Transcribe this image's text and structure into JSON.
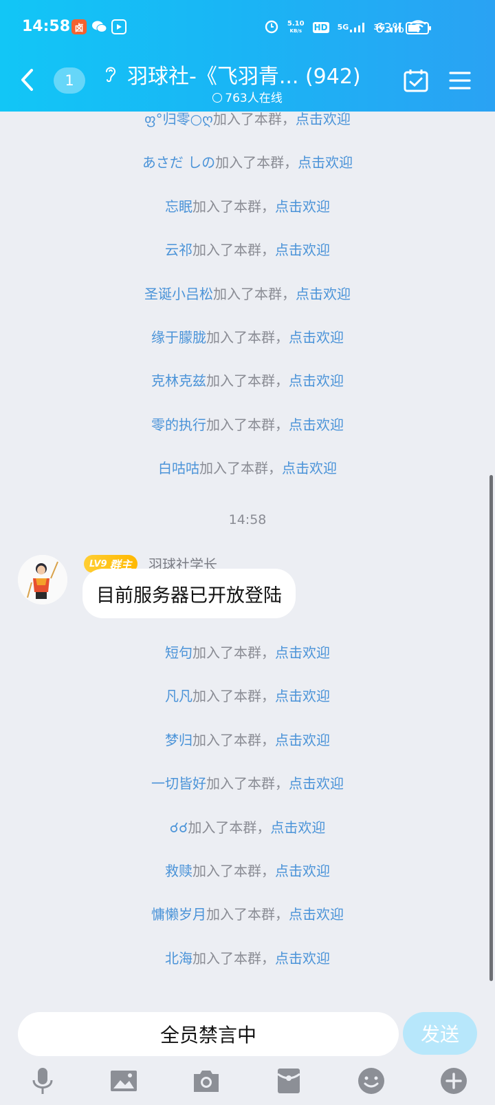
{
  "status_bar": {
    "time": "14:58",
    "net_speed_top": "5.10",
    "net_speed_unit": "KB/s",
    "hd": "HD",
    "hd_sub": "1",
    "net1": "5G",
    "net2": "3G",
    "battery_percent": "63%",
    "battery_level": 0.63
  },
  "nav": {
    "unread_count": "1",
    "title": "羽球社-《飞羽青... (942)",
    "online": "763人在线"
  },
  "system_messages_top": [
    {
      "name": "ფ°归零○ღ",
      "text": "加入了本群，",
      "link": "点击欢迎"
    },
    {
      "name": "あさだ しの",
      "text": "加入了本群，",
      "link": "点击欢迎"
    },
    {
      "name": "忘眠",
      "text": "加入了本群，",
      "link": "点击欢迎"
    },
    {
      "name": "云祁",
      "text": "加入了本群，",
      "link": "点击欢迎"
    },
    {
      "name": "圣诞小吕松",
      "text": "加入了本群，",
      "link": "点击欢迎"
    },
    {
      "name": "缘于朦胧",
      "text": "加入了本群，",
      "link": "点击欢迎"
    },
    {
      "name": "克林克兹",
      "text": "加入了本群，",
      "link": "点击欢迎"
    },
    {
      "name": "零的执行",
      "text": "加入了本群，",
      "link": "点击欢迎"
    },
    {
      "name": "白咕咕",
      "text": "加入了本群，",
      "link": "点击欢迎"
    }
  ],
  "timestamp": "14:58",
  "message": {
    "level": "LV9",
    "role": "群主",
    "sender": "羽球社学长",
    "text": "目前服务器已开放登陆"
  },
  "system_messages_bottom": [
    {
      "name": "短句",
      "text": "加入了本群，",
      "link": "点击欢迎"
    },
    {
      "name": "凡凡",
      "text": "加入了本群，",
      "link": "点击欢迎"
    },
    {
      "name": "梦归",
      "text": "加入了本群，",
      "link": "点击欢迎"
    },
    {
      "name": "一切皆好",
      "text": "加入了本群，",
      "link": "点击欢迎"
    },
    {
      "name": "☌☌",
      "text": "加入了本群，",
      "link": "点击欢迎"
    },
    {
      "name": "救赎",
      "text": "加入了本群，",
      "link": "点击欢迎"
    },
    {
      "name": "慵懒岁月",
      "text": "加入了本群，",
      "link": "点击欢迎"
    },
    {
      "name": "北海",
      "text": "加入了本群，",
      "link": "点击欢迎"
    }
  ],
  "input": {
    "value": "全员禁言中",
    "send_label": "发送"
  },
  "toolbar": [
    "microphone-icon",
    "image-icon",
    "camera-icon",
    "red-packet-icon",
    "emoji-icon",
    "plus-icon"
  ]
}
